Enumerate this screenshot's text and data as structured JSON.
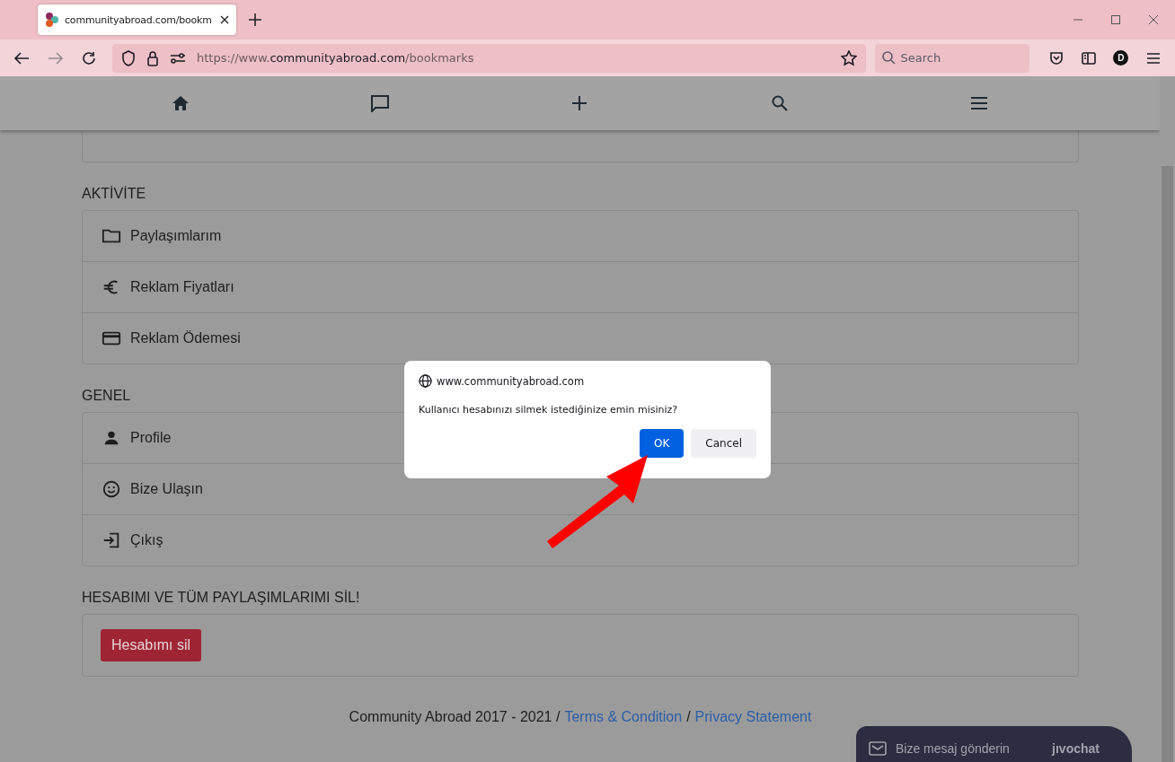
{
  "browser": {
    "tab_title": "communityabroad.com/bookm",
    "url_scheme": "https://www.",
    "url_host": "communityabroad.com",
    "url_path": "/bookmarks",
    "search_placeholder": "Search",
    "profile_initial": "D"
  },
  "sections": [
    {
      "title": "AKTİVİTE",
      "items": [
        {
          "kind": "folder",
          "label": "Paylaşımlarım"
        },
        {
          "kind": "euro",
          "label": "Reklam Fiyatları"
        },
        {
          "kind": "card",
          "label": "Reklam Ödemesi"
        }
      ]
    },
    {
      "title": "GENEL",
      "items": [
        {
          "kind": "person",
          "label": "Profile"
        },
        {
          "kind": "smile",
          "label": "Bize Ulaşın"
        },
        {
          "kind": "exit",
          "label": "Çıkış"
        }
      ]
    }
  ],
  "delete_section": {
    "title": "HESABIMI VE TÜM PAYLAŞIMLARIMI SİL!",
    "button": "Hesabımı sil"
  },
  "footer": {
    "text": "Community Abroad 2017 - 2021 /",
    "links": [
      "Terms & Condition",
      "Privacy Statement"
    ],
    "separator": "/"
  },
  "dialog": {
    "origin": "www.communityabroad.com",
    "message": "Kullanıcı hesabınızı silmek istediğinize emin misiniz?",
    "buttons": [
      {
        "kind": "primary",
        "label": "OK"
      },
      {
        "kind": "secondary",
        "label": "Cancel"
      }
    ]
  },
  "chat_widget": {
    "label": "Bize mesaj gönderin",
    "brand": "jıvochat"
  }
}
